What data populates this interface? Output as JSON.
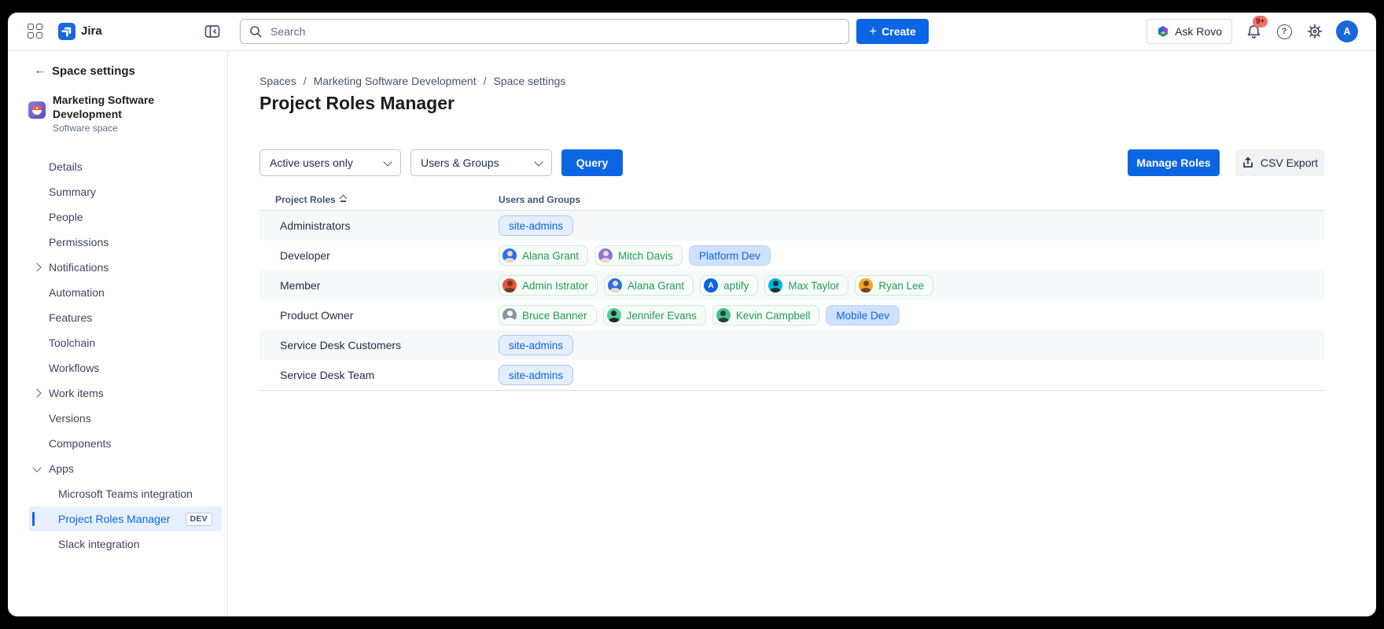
{
  "topbar": {
    "app_name": "Jira",
    "search_placeholder": "Search",
    "create_label": "Create",
    "ask_rovo_label": "Ask Rovo",
    "notifications_badge": "9+",
    "avatar_initial": "A"
  },
  "icons": {
    "back_glyph": "←",
    "plus_glyph": "+",
    "help_glyph": "?"
  },
  "colors": {
    "accent_blue": "#0C66E4",
    "selected_bg": "#E7F0FE",
    "user_pill_text": "#1F9D54",
    "group_pill_bg": "#CFE1FD",
    "badge_bg": "#F87168",
    "row_stripe": "#F7F8F9"
  },
  "sidebar": {
    "back_label": "Space settings",
    "space": {
      "name": "Marketing Software Development",
      "type": "Software space"
    },
    "items": [
      {
        "label": "Details"
      },
      {
        "label": "Summary"
      },
      {
        "label": "People"
      },
      {
        "label": "Permissions"
      },
      {
        "label": "Notifications",
        "chevron": "right"
      },
      {
        "label": "Automation"
      },
      {
        "label": "Features"
      },
      {
        "label": "Toolchain"
      },
      {
        "label": "Workflows"
      },
      {
        "label": "Work items",
        "chevron": "right"
      },
      {
        "label": "Versions"
      },
      {
        "label": "Components"
      },
      {
        "label": "Apps",
        "chevron": "down"
      },
      {
        "label": "Microsoft Teams integration",
        "indent": true
      },
      {
        "label": "Project Roles Manager",
        "indent": true,
        "selected": true,
        "badge": "DEV"
      },
      {
        "label": "Slack integration",
        "indent": true
      }
    ]
  },
  "main": {
    "breadcrumb": [
      "Spaces",
      "Marketing Software Development",
      "Space settings"
    ],
    "breadcrumb_separator": "/",
    "title": "Project Roles Manager",
    "toolbar": {
      "filter_users": "Active users only",
      "filter_type": "Users & Groups",
      "query_label": "Query",
      "manage_roles_label": "Manage Roles",
      "csv_export_label": "CSV Export"
    },
    "table": {
      "columns": [
        "Project Roles",
        "Users and Groups"
      ],
      "rows": [
        {
          "role": "Administrators",
          "members": [
            {
              "kind": "group",
              "variant": "light",
              "label": "site-admins"
            }
          ]
        },
        {
          "role": "Developer",
          "members": [
            {
              "kind": "user",
              "label": "Alana Grant",
              "avatar_color": "#2970E8",
              "sil": "#F0D6C2"
            },
            {
              "kind": "user",
              "label": "Mitch Davis",
              "avatar_color": "#8777D9",
              "sil": "#EED9C5"
            },
            {
              "kind": "group",
              "variant": "solid",
              "label": "Platform Dev"
            }
          ]
        },
        {
          "role": "Member",
          "members": [
            {
              "kind": "user",
              "label": "Admin Istrator",
              "avatar_color": "#E8553A",
              "sil": "#6B3A2A"
            },
            {
              "kind": "user",
              "label": "Alana Grant",
              "avatar_color": "#2970E8",
              "sil": "#F0D6C2"
            },
            {
              "kind": "user",
              "label": "aptify",
              "avatar_color": "#0B63E5",
              "letter": "A"
            },
            {
              "kind": "user",
              "label": "Max Taylor",
              "avatar_color": "#00B8D9",
              "sil": "#17323F"
            },
            {
              "kind": "user",
              "label": "Ryan Lee",
              "avatar_color": "#F5A623",
              "sil": "#75421F"
            }
          ]
        },
        {
          "role": "Product Owner",
          "members": [
            {
              "kind": "user",
              "label": "Bruce Banner",
              "avatar_color": "#8993A4",
              "sil": "#FFFFFF"
            },
            {
              "kind": "user",
              "label": "Jennifer Evans",
              "avatar_color": "#4BCE97",
              "sil": "#2F2430"
            },
            {
              "kind": "user",
              "label": "Kevin Campbell",
              "avatar_color": "#44C08A",
              "sil": "#27413B"
            },
            {
              "kind": "group",
              "variant": "solid",
              "label": "Mobile Dev"
            }
          ]
        },
        {
          "role": "Service Desk Customers",
          "members": [
            {
              "kind": "group",
              "variant": "light",
              "label": "site-admins"
            }
          ]
        },
        {
          "role": "Service Desk Team",
          "members": [
            {
              "kind": "group",
              "variant": "light",
              "label": "site-admins"
            }
          ]
        }
      ]
    }
  }
}
